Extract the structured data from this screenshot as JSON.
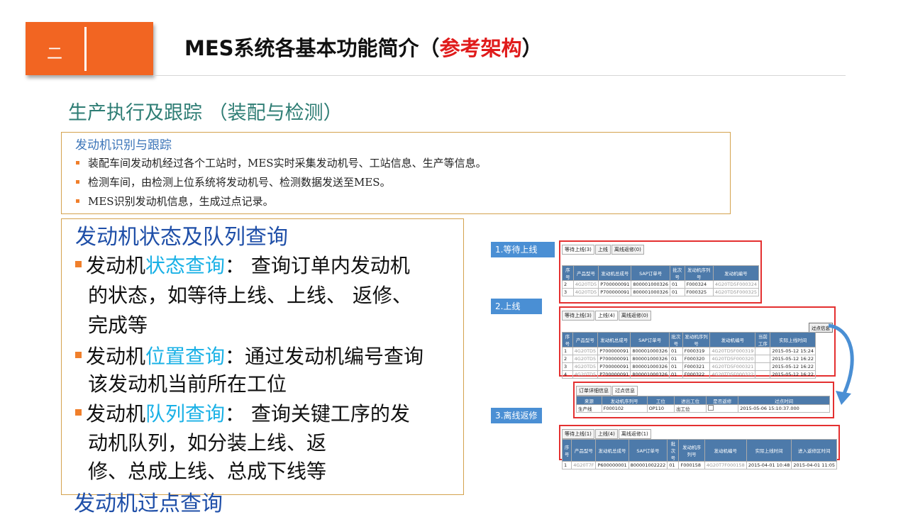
{
  "header": {
    "section_number": "二",
    "title_prefix": "MES系统各基本功能简介（",
    "title_highlight": "参考架构",
    "title_suffix": "）"
  },
  "subtitle": "生产执行及跟踪 （装配与检测）",
  "box1": {
    "title": "发动机识别与跟踪",
    "bullets": [
      "装配车间发动机经过各个工站时，MES实时采集发动机号、工站信息、生产等信息。",
      "检测车间，由检测上位系统将发动机号、检测数据发送至MES。",
      "MES识别发动机信息，生成过点记录。"
    ]
  },
  "box2": {
    "title": "发动机状态及队列查询",
    "items": [
      {
        "prefix": "发动机",
        "highlight": "状态查询",
        "text": "：  查询订单内发动机",
        "lines": [
          "的状态，如等待上线、上线、 返修、",
          "完成等"
        ]
      },
      {
        "prefix": "发动机",
        "highlight": "位置查询",
        "text": "：通过发动机编号查询",
        "lines": [
          "该发动机当前所在工位"
        ]
      },
      {
        "prefix": "发动机",
        "highlight": "队列查询",
        "text": "：  查询关键工序的发",
        "lines": [
          "动机队列，如分装上线、返",
          "修、总成上线、总成下线等"
        ]
      }
    ],
    "last_title": "发动机过点查询"
  },
  "steps": {
    "s1": "1.等待上线",
    "s2": "2.上线",
    "s3": "3.离线返修"
  },
  "tabs": {
    "waiting": "等待上线(3)",
    "online": "上线(4)",
    "online_short": "上线",
    "offline": "离线返修(0)",
    "waiting1": "等待上线(1)",
    "offline1": "离线返修(1)",
    "detail": "订单详细信息",
    "pass": "过点信息"
  },
  "table1": {
    "headers": [
      "序号",
      "产品型号",
      "发动机总成号",
      "SAP订单号",
      "批次号",
      "发动机序列号",
      "发动机编号"
    ],
    "rows": [
      [
        "2",
        "4G20TD5",
        "P700000091",
        "800001000326",
        "01",
        "F000324",
        "4G20TD5F000324"
      ],
      [
        "3",
        "4G20TD5",
        "P700000091",
        "800001000326",
        "01",
        "F000325",
        "4G20TD5F000325"
      ]
    ]
  },
  "table2": {
    "button": "过点信息",
    "headers": [
      "序号",
      "产品型号",
      "发动机总成号",
      "SAP订单号",
      "批次号",
      "发动机序列号",
      "发动机编号",
      "当前工序",
      "实际上线时间"
    ],
    "rows": [
      [
        "1",
        "4G20TD5",
        "P700000091",
        "800001000326",
        "01",
        "F000319",
        "4G20TD5F000319",
        "",
        "2015-05-12 15:24"
      ],
      [
        "2",
        "4G20TD5",
        "P700000091",
        "800001000326",
        "01",
        "F000320",
        "4G20TD5F000320",
        "",
        "2015-05-12 16:22"
      ],
      [
        "3",
        "4G20TD5",
        "P700000091",
        "800001000326",
        "01",
        "F000321",
        "4G20TD5F000321",
        "",
        "2015-05-12 16:22"
      ],
      [
        "4",
        "4G20TD5",
        "P700000091",
        "800001000326",
        "01",
        "F000322",
        "4G20TD5F000322",
        "",
        "2015-05-12 16:22"
      ]
    ]
  },
  "table_detail": {
    "headers": [
      "来源",
      "发动机序列号",
      "工位",
      "进出工位",
      "是否返修",
      "过点时间"
    ],
    "row": [
      "生产线",
      "F000102",
      "OP110",
      "出工位",
      "",
      "2015-05-06 15:10:37.000"
    ]
  },
  "table3": {
    "headers": [
      "序号",
      "产品型号",
      "发动机总成号",
      "SAP订单号",
      "批次号",
      "发动机序列号",
      "发动机编号",
      "实际上线时间",
      "进入返修区时间"
    ],
    "rows": [
      [
        "1",
        "4G20T7F",
        "P600000001",
        "800001002222",
        "01",
        "F000158",
        "4G20T7F000158",
        "2015-04-01 10:48",
        "2015-04-01 11:05"
      ]
    ]
  },
  "colors": {
    "accent_orange": "#f26522",
    "title_red": "#e01b1b",
    "highlight_blue": "#1ab1e6",
    "heading_blue": "#1f4fa8",
    "frame_red": "#e43030"
  }
}
